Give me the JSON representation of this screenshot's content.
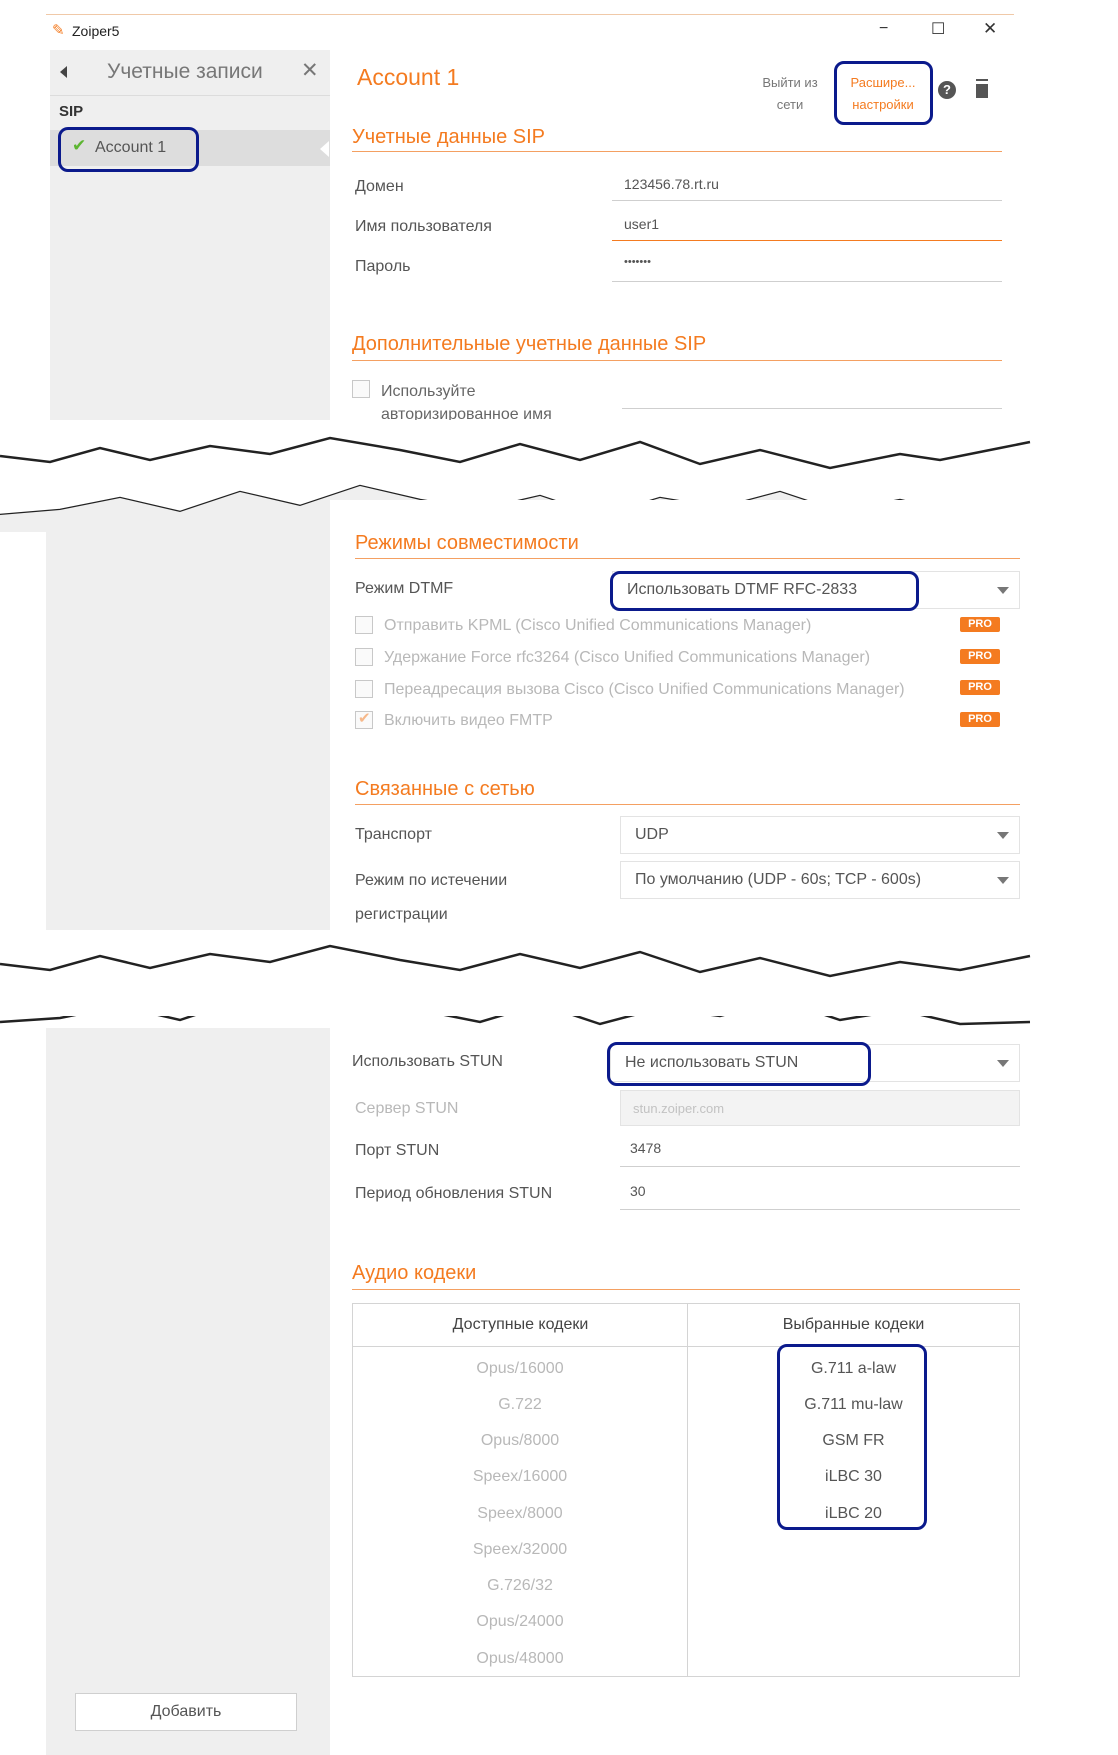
{
  "titlebar": {
    "app_name": "Zoiper5",
    "minimize": "−",
    "maximize": "☐",
    "close": "✕"
  },
  "sidebar": {
    "title": "Учетные записи",
    "close": "✕",
    "group": "SIP",
    "accounts": [
      {
        "label": "Account 1",
        "status": "registered"
      }
    ],
    "add_button": "Добавить"
  },
  "header": {
    "account_title": "Account 1",
    "logout_label": "Выйти из сети",
    "advanced_label": "Расшире... настройки"
  },
  "sip_credentials": {
    "title": "Учетные данные SIP",
    "domain_label": "Домен",
    "domain_value": "123456.78.rt.ru",
    "username_label": "Имя пользователя",
    "username_value": "user1",
    "password_label": "Пароль",
    "password_value": "•••••••"
  },
  "additional_sip": {
    "title": "Дополнительные учетные данные SIP",
    "use_auth_name_label": "Используйте авторизированное имя",
    "use_auth_name_checked": false
  },
  "compatibility": {
    "title": "Режимы совместимости",
    "dtmf_label": "Режим DTMF",
    "dtmf_value": "Использовать DTMF RFC-2833",
    "options": [
      {
        "label": "Отправить KPML (Cisco Unified Communications Manager)",
        "checked": false,
        "badge": "PRO"
      },
      {
        "label": "Удержание Force rfc3264 (Cisco Unified Communications Manager)",
        "checked": false,
        "badge": "PRO"
      },
      {
        "label": "Переадресация вызова Cisco (Cisco Unified Communications Manager)",
        "checked": false,
        "badge": "PRO"
      },
      {
        "label": "Включить видео FMTP",
        "checked": true,
        "badge": "PRO"
      }
    ]
  },
  "network": {
    "title": "Связанные с сетью",
    "transport_label": "Транспорт",
    "transport_value": "UDP",
    "reg_expiry_label": "Режим по истечении регистрации",
    "reg_expiry_value": "По умолчанию (UDP - 60s; TCP - 600s)"
  },
  "stun": {
    "use_label": "Использовать STUN",
    "use_value": "Не использовать STUN",
    "server_label": "Сервер STUN",
    "server_value": "stun.zoiper.com",
    "port_label": "Порт STUN",
    "port_value": "3478",
    "refresh_label": "Период обновления STUN",
    "refresh_value": "30"
  },
  "audio_codecs": {
    "title": "Аудио кодеки",
    "available_header": "Доступные кодеки",
    "selected_header": "Выбранные кодеки",
    "available": [
      "Opus/16000",
      "G.722",
      "Opus/8000",
      "Speex/16000",
      "Speex/8000",
      "Speex/32000",
      "G.726/32",
      "Opus/24000",
      "Opus/48000"
    ],
    "selected": [
      "G.711 a-law",
      "G.711 mu-law",
      "GSM FR",
      "iLBC 30",
      "iLBC 20"
    ]
  },
  "colors": {
    "accent": "#f47b20",
    "highlight": "#0b1a8c",
    "sidebar_bg": "#efefef"
  }
}
